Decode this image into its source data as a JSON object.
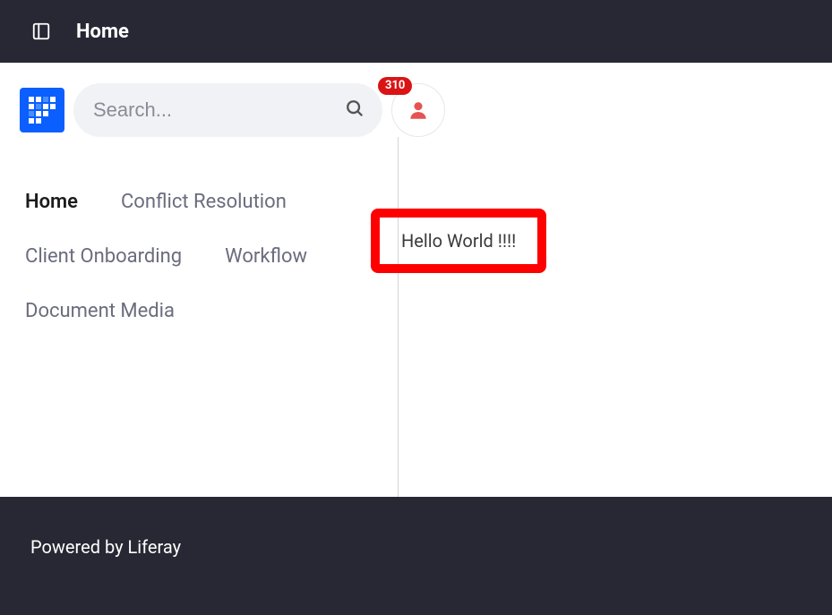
{
  "topbar": {
    "title": "Home"
  },
  "search": {
    "placeholder": "Search..."
  },
  "user": {
    "notification_count": "310"
  },
  "nav": {
    "items": [
      {
        "label": "Home",
        "active": true
      },
      {
        "label": "Conflict Resolution",
        "active": false
      },
      {
        "label": "Client Onboarding",
        "active": false
      },
      {
        "label": "Workflow",
        "active": false
      },
      {
        "label": "Document Media",
        "active": false
      }
    ]
  },
  "portlet": {
    "message": "Hello World !!!!"
  },
  "footer": {
    "text": "Powered by Liferay"
  },
  "colors": {
    "primary": "#0b5fff",
    "dark": "#272833",
    "badge": "#da1414",
    "highlight": "#ff0000"
  }
}
